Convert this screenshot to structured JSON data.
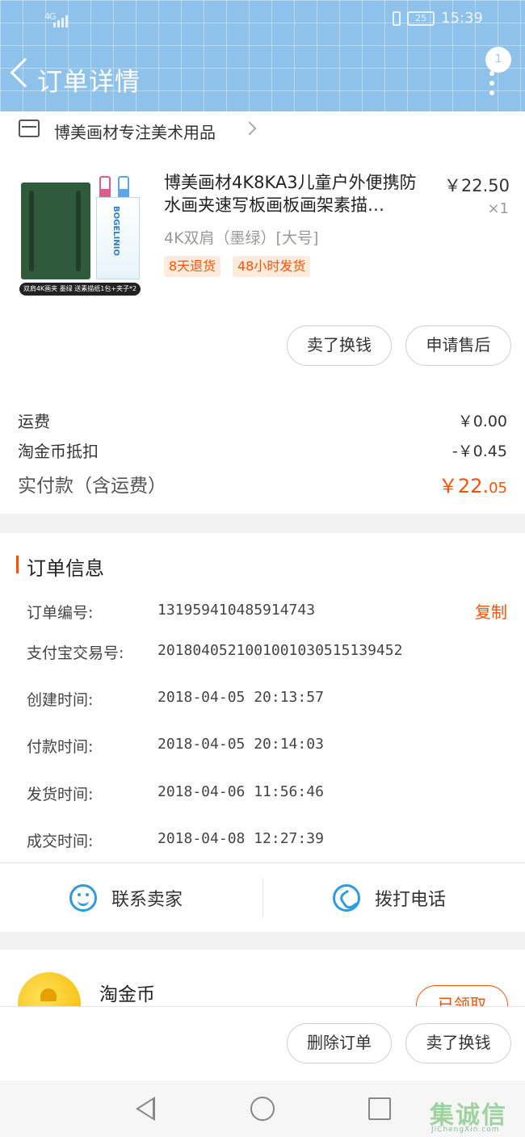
{
  "status_bar": {
    "network": "4G",
    "battery": "25",
    "time": "15:39"
  },
  "header": {
    "title": "订单详情",
    "notification_count": "1"
  },
  "shop": {
    "name": "博美画材专注美术用品"
  },
  "product": {
    "title": "博美画材4K8KA3儿童户外便携防水画夹速写板画板画架素描…",
    "price": "￥22.50",
    "quantity": "×1",
    "sku": "4K双肩（墨绿）[大号]",
    "tags": [
      "8天退货",
      "48小时发货"
    ],
    "image_caption": "双肩4K画夹  墨绿  送素描纸1包+夹子*2",
    "image_brand": "BOGELINIO",
    "actions": [
      "卖了换钱",
      "申请售后"
    ]
  },
  "fees": {
    "shipping_label": "运费",
    "shipping_value": "￥0.00",
    "coin_label": "淘金币抵扣",
    "coin_value": "-￥0.45",
    "total_label": "实付款（含运费）",
    "total_main": "￥22.",
    "total_cents": "05"
  },
  "order_info": {
    "section_title": "订单信息",
    "copy_label": "复制",
    "rows": [
      {
        "key": "订单编号:",
        "value": "131959410485914743"
      },
      {
        "key": "支付宝交易号:",
        "value": "2018040521001001030515139452"
      },
      {
        "key": "创建时间:",
        "value": "2018-04-05 20:13:57"
      },
      {
        "key": "付款时间:",
        "value": "2018-04-05 20:14:03"
      },
      {
        "key": "发货时间:",
        "value": "2018-04-06 11:56:46"
      },
      {
        "key": "成交时间:",
        "value": "2018-04-08 12:27:39"
      }
    ]
  },
  "contact": {
    "seller_label": "联系卖家",
    "call_label": "拨打电话"
  },
  "coin_card": {
    "label": "淘金币",
    "button": "已领取"
  },
  "bottom_actions": {
    "delete_label": "删除订单",
    "sell_label": "卖了换钱"
  },
  "watermark": {
    "main": "集诚信",
    "sub": "JiChengXin.com"
  },
  "colors": {
    "accent": "#ff5000",
    "header_blue": "#8ec2ea",
    "link_blue": "#2d9be0"
  }
}
